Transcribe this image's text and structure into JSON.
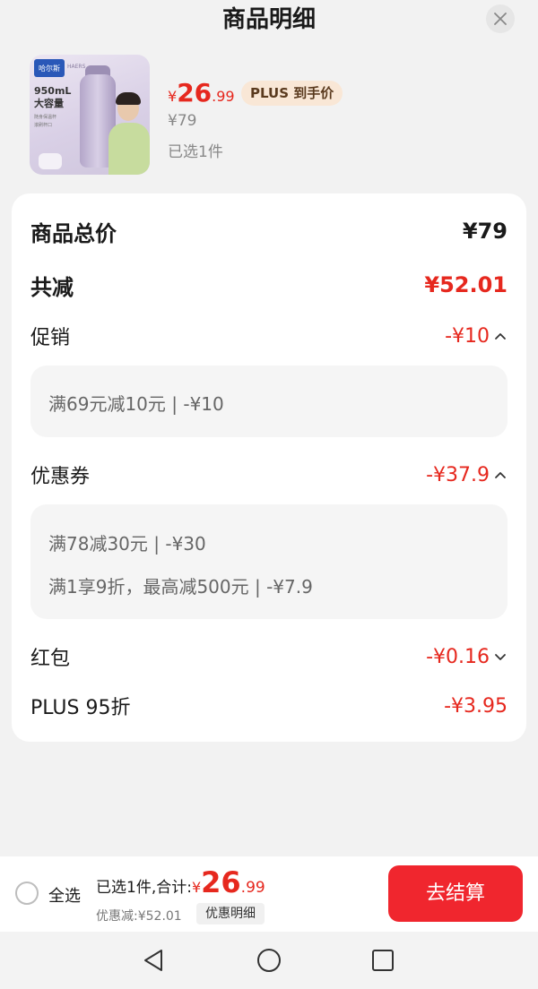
{
  "header": {
    "title": "商品明细"
  },
  "product": {
    "thumb": {
      "brand": "哈尔斯",
      "brand_sub": "HAERS",
      "caption_line1": "950mL",
      "caption_line2": "大容量",
      "note_line1": "随身保温杯",
      "note_line2": "滚刷杯口"
    },
    "price_currency": "¥",
    "price_int": "26",
    "price_dec": ".99",
    "plus_badge": "PLUS 到手价",
    "original_price": "¥79",
    "selected_count": "已选1件"
  },
  "breakdown": {
    "total": {
      "label": "商品总价",
      "value": "¥79"
    },
    "reduction": {
      "label": "共减",
      "value": "¥52.01"
    },
    "promotion": {
      "label": "促销",
      "value": "-¥10",
      "items": [
        "满69元减10元 | -¥10"
      ]
    },
    "coupon": {
      "label": "优惠券",
      "value": "-¥37.9",
      "items": [
        "满78减30元 | -¥30",
        "满1享9折，最高减500元 | -¥7.9"
      ]
    },
    "red_packet": {
      "label": "红包",
      "value": "-¥0.16"
    },
    "plus_discount": {
      "label": "PLUS 95折",
      "value": "-¥3.95"
    }
  },
  "bottom_bar": {
    "select_all": "全选",
    "total_label": "已选1件,合计:",
    "total_currency": "¥",
    "total_int": "26",
    "total_dec": ".99",
    "discount_text": "优惠减:¥52.01",
    "detail_button": "优惠明细",
    "checkout_button": "去结算"
  },
  "colors": {
    "accent_red": "#e6281e",
    "checkout_bg": "#f0262e",
    "badge_bg": "#f9e7d6"
  },
  "icons": {
    "close": "close-icon",
    "chevron_up": "chevron-up-icon",
    "chevron_down": "chevron-down-icon",
    "nav_back": "back-triangle-icon",
    "nav_home": "home-circle-icon",
    "nav_recent": "recent-square-icon"
  }
}
